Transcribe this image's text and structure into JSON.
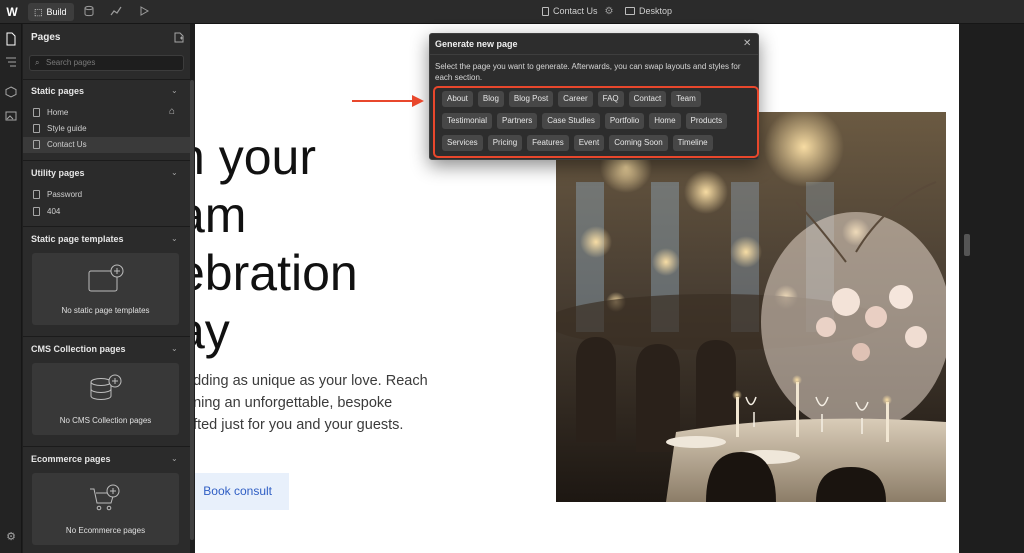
{
  "topbar": {
    "build_label": "Build",
    "page_name": "Contact Us",
    "breakpoint": "Desktop"
  },
  "panel": {
    "title": "Pages",
    "search_placeholder": "Search pages",
    "sections": {
      "static": {
        "title": "Static pages",
        "items": [
          "Home",
          "Style guide",
          "Contact Us"
        ]
      },
      "utility": {
        "title": "Utility pages",
        "items": [
          "Password",
          "404"
        ]
      },
      "templates": {
        "title": "Static page templates",
        "empty": "No static page templates"
      },
      "cms": {
        "title": "CMS Collection pages",
        "empty": "No CMS Collection pages"
      },
      "ecommerce": {
        "title": "Ecommerce pages",
        "empty": "No Ecommerce pages"
      }
    }
  },
  "canvas": {
    "hero_title": "n your\nam\nebration\nay",
    "hero_body": "edding as unique as your love. Reach\nnning an unforgettable, bespoke\nafted just for you and your guests.",
    "cta": "Book consult"
  },
  "modal": {
    "title": "Generate new page",
    "description": "Select the page you want to generate. Afterwards, you can swap layouts and styles for each section.",
    "row1": [
      "About",
      "Blog",
      "Blog Post",
      "Career",
      "FAQ",
      "Contact",
      "Team"
    ],
    "row2": [
      "Testimonial",
      "Partners",
      "Case Studies",
      "Portfolio",
      "Home",
      "Products"
    ],
    "row3": [
      "Services",
      "Pricing",
      "Features",
      "Event",
      "Coming Soon",
      "Timeline"
    ]
  },
  "colors": {
    "highlight": "#e8472c",
    "cta_text": "#2f5ec4",
    "cta_bg": "#e8f0fb"
  }
}
